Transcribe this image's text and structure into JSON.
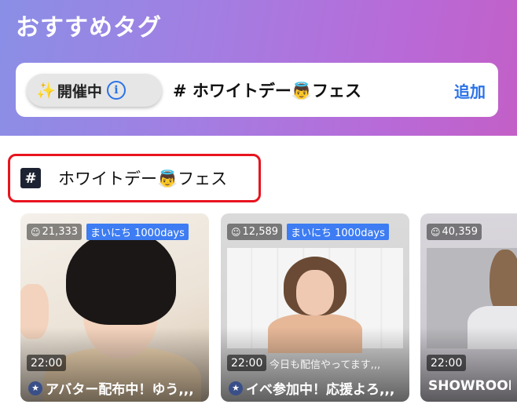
{
  "header": {
    "title": "おすすめタグ"
  },
  "featured_tag": {
    "status_label": "開催中",
    "sparkle_glyph": "✨",
    "info_glyph": "i",
    "tag_text": "# ホワイトデー👼フェス",
    "add_label": "追加"
  },
  "hashtag": {
    "icon_glyph": "#",
    "label": "ホワイトデー👼フェス"
  },
  "rooms": [
    {
      "viewers": "21,333",
      "streak": "まいにち 1000days",
      "time": "22:00",
      "telop": "",
      "title": "アバター配布中！ゆう,,,",
      "has_star": true
    },
    {
      "viewers": "12,589",
      "streak": "まいにち 1000days",
      "time": "22:00",
      "telop": "今日も配信やってます,,,",
      "title": "イベ参加中！応援よろ,,,",
      "has_star": true
    },
    {
      "viewers": "40,359",
      "streak": "",
      "time": "22:00",
      "telop": "",
      "title": "SHOWROOM",
      "has_star": false
    }
  ],
  "colors": {
    "accent_blue": "#2a72e8",
    "highlight_red": "#e8141e",
    "streak_badge": "#3d7cf2"
  }
}
